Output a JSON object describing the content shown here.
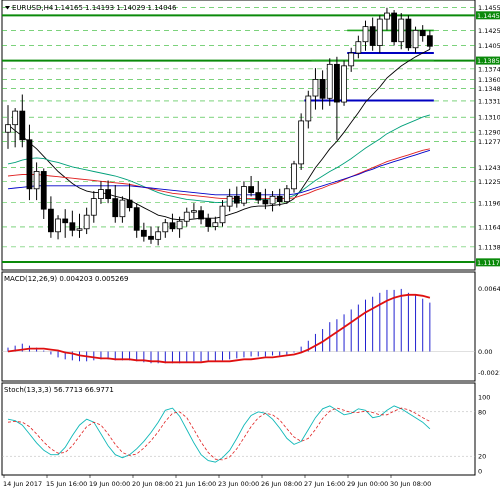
{
  "main": {
    "symbol_title": "EURUSD,H4",
    "ohlc": "1.14165 1.14193 1.14029 1.14046",
    "price_labels": [
      "1.14555",
      "1.14450",
      "1.14250",
      "1.14050",
      "1.13850",
      "1.13740",
      "1.13600",
      "1.13480",
      "1.13315",
      "1.13100",
      "1.12900",
      "1.12775",
      "1.12430",
      "1.12250",
      "1.11965",
      "1.11645",
      "1.11380"
    ],
    "green_tag_labels": [
      "1.14450",
      "1.13850",
      "1.11175"
    ],
    "ylim": [
      1.111,
      1.146
    ],
    "candles": [
      [
        1.129,
        1.1326,
        1.1268,
        1.13
      ],
      [
        1.13,
        1.1322,
        1.127,
        1.1318
      ],
      [
        1.1318,
        1.134,
        1.127,
        1.128
      ],
      [
        1.128,
        1.13,
        1.12,
        1.1215
      ],
      [
        1.1215,
        1.125,
        1.12,
        1.1238
      ],
      [
        1.1238,
        1.1242,
        1.1175,
        1.1188
      ],
      [
        1.1188,
        1.1205,
        1.115,
        1.1158
      ],
      [
        1.1158,
        1.118,
        1.1148,
        1.1175
      ],
      [
        1.1175,
        1.1188,
        1.115,
        1.117
      ],
      [
        1.117,
        1.1186,
        1.1152,
        1.116
      ],
      [
        1.116,
        1.1182,
        1.115,
        1.1162
      ],
      [
        1.1162,
        1.119,
        1.1155,
        1.118
      ],
      [
        1.118,
        1.1212,
        1.117,
        1.1202
      ],
      [
        1.1202,
        1.1225,
        1.1195,
        1.1214
      ],
      [
        1.1214,
        1.1226,
        1.1196,
        1.1202
      ],
      [
        1.1202,
        1.122,
        1.117,
        1.1178
      ],
      [
        1.1178,
        1.1205,
        1.117,
        1.12
      ],
      [
        1.12,
        1.1222,
        1.1185,
        1.119
      ],
      [
        1.119,
        1.1196,
        1.115,
        1.116
      ],
      [
        1.116,
        1.117,
        1.1145,
        1.1152
      ],
      [
        1.1152,
        1.1165,
        1.1142,
        1.1148
      ],
      [
        1.1148,
        1.1165,
        1.114,
        1.1158
      ],
      [
        1.1158,
        1.1175,
        1.115,
        1.117
      ],
      [
        1.117,
        1.1182,
        1.1158,
        1.1162
      ],
      [
        1.1162,
        1.1178,
        1.115,
        1.1172
      ],
      [
        1.1172,
        1.119,
        1.1165,
        1.1184
      ],
      [
        1.1184,
        1.1196,
        1.1176,
        1.1186
      ],
      [
        1.1186,
        1.1192,
        1.1168,
        1.1175
      ],
      [
        1.1175,
        1.1182,
        1.1158,
        1.1165
      ],
      [
        1.1165,
        1.1178,
        1.116,
        1.117
      ],
      [
        1.117,
        1.12,
        1.1165,
        1.1192
      ],
      [
        1.1192,
        1.1215,
        1.1185,
        1.1205
      ],
      [
        1.1205,
        1.1218,
        1.119,
        1.1196
      ],
      [
        1.1196,
        1.1225,
        1.1192,
        1.1218
      ],
      [
        1.1218,
        1.1232,
        1.1205,
        1.121
      ],
      [
        1.121,
        1.1225,
        1.1195,
        1.12
      ],
      [
        1.12,
        1.1215,
        1.1188,
        1.1195
      ],
      [
        1.1195,
        1.1212,
        1.1185,
        1.1205
      ],
      [
        1.1205,
        1.1215,
        1.1192,
        1.1198
      ],
      [
        1.1198,
        1.122,
        1.1195,
        1.1215
      ],
      [
        1.1215,
        1.1252,
        1.121,
        1.1248
      ],
      [
        1.1248,
        1.1315,
        1.124,
        1.1305
      ],
      [
        1.1305,
        1.1345,
        1.1295,
        1.1338
      ],
      [
        1.1338,
        1.1375,
        1.132,
        1.136
      ],
      [
        1.136,
        1.1372,
        1.132,
        1.1335
      ],
      [
        1.1335,
        1.1388,
        1.1325,
        1.138
      ],
      [
        1.138,
        1.139,
        1.128,
        1.133
      ],
      [
        1.133,
        1.1385,
        1.1325,
        1.1378
      ],
      [
        1.1378,
        1.1402,
        1.137,
        1.1395
      ],
      [
        1.1395,
        1.1418,
        1.1388,
        1.141
      ],
      [
        1.141,
        1.1438,
        1.1398,
        1.143
      ],
      [
        1.143,
        1.1442,
        1.1398,
        1.1405
      ],
      [
        1.1405,
        1.1445,
        1.1395,
        1.144
      ],
      [
        1.144,
        1.1455,
        1.1425,
        1.1448
      ],
      [
        1.1448,
        1.1452,
        1.1405,
        1.141
      ],
      [
        1.141,
        1.1448,
        1.14,
        1.144
      ],
      [
        1.144,
        1.1445,
        1.1398,
        1.1402
      ],
      [
        1.1402,
        1.143,
        1.1395,
        1.1425
      ],
      [
        1.1425,
        1.1432,
        1.141,
        1.1418
      ],
      [
        1.1418,
        1.1425,
        1.14,
        1.1404
      ]
    ],
    "moving_averages": [
      {
        "color": "#000000",
        "values": [
          1.13,
          1.1292,
          1.1285,
          1.1276,
          1.1268,
          1.1258,
          1.1248,
          1.1238,
          1.123,
          1.1222,
          1.1216,
          1.1212,
          1.121,
          1.121,
          1.1208,
          1.1205,
          1.1203,
          1.12,
          1.1195,
          1.119,
          1.1185,
          1.118,
          1.1178,
          1.1175,
          1.1174,
          1.1174,
          1.1175,
          1.1176,
          1.1176,
          1.1176,
          1.1178,
          1.1181,
          1.1184,
          1.1188,
          1.1191,
          1.1192,
          1.1192,
          1.1193,
          1.1194,
          1.1196,
          1.1202,
          1.1214,
          1.1228,
          1.1243,
          1.1255,
          1.1268,
          1.1278,
          1.129,
          1.1303,
          1.1316,
          1.133,
          1.134,
          1.135,
          1.1362,
          1.137,
          1.1378,
          1.1384,
          1.139,
          1.1395,
          1.14
        ]
      },
      {
        "color": "#00a07a",
        "values": [
          1.1248,
          1.125,
          1.1253,
          1.1255,
          1.1256,
          1.1255,
          1.1252,
          1.125,
          1.1247,
          1.1244,
          1.1242,
          1.124,
          1.1238,
          1.1236,
          1.1234,
          1.1232,
          1.1229,
          1.1226,
          1.1222,
          1.1218,
          1.1214,
          1.121,
          1.1207,
          1.1205,
          1.1203,
          1.1201,
          1.12,
          1.1199,
          1.1198,
          1.1197,
          1.1197,
          1.1198,
          1.1199,
          1.12,
          1.1201,
          1.1201,
          1.1201,
          1.1202,
          1.1202,
          1.1203,
          1.1206,
          1.1212,
          1.1219,
          1.1226,
          1.1232,
          1.1238,
          1.1243,
          1.1249,
          1.1255,
          1.1262,
          1.1269,
          1.1275,
          1.1281,
          1.1288,
          1.1293,
          1.1298,
          1.1302,
          1.1306,
          1.131,
          1.1313
        ]
      },
      {
        "color": "#e02020",
        "values": [
          1.1232,
          1.1233,
          1.1234,
          1.1234,
          1.1234,
          1.1233,
          1.1232,
          1.1231,
          1.123,
          1.1229,
          1.1228,
          1.1227,
          1.1226,
          1.1225,
          1.1224,
          1.1223,
          1.1222,
          1.1221,
          1.1219,
          1.1217,
          1.1215,
          1.1213,
          1.1211,
          1.1209,
          1.1208,
          1.1207,
          1.1206,
          1.1205,
          1.1204,
          1.1203,
          1.1202,
          1.1202,
          1.1202,
          1.1202,
          1.1202,
          1.1202,
          1.1202,
          1.1202,
          1.1202,
          1.1202,
          1.1203,
          1.1206,
          1.1209,
          1.1213,
          1.1216,
          1.122,
          1.1223,
          1.1227,
          1.1231,
          1.1235,
          1.1239,
          1.1243,
          1.1247,
          1.1251,
          1.1254,
          1.1257,
          1.126,
          1.1263,
          1.1266,
          1.1268
        ]
      },
      {
        "color": "#0000c8",
        "values": [
          1.1215,
          1.1216,
          1.1217,
          1.1218,
          1.1219,
          1.1219,
          1.1219,
          1.1219,
          1.1219,
          1.1219,
          1.1219,
          1.1219,
          1.1219,
          1.1219,
          1.1219,
          1.1219,
          1.1219,
          1.1219,
          1.1218,
          1.1217,
          1.1216,
          1.1215,
          1.1214,
          1.1213,
          1.1212,
          1.1211,
          1.121,
          1.1209,
          1.1208,
          1.1207,
          1.1207,
          1.1207,
          1.1207,
          1.1207,
          1.1207,
          1.1207,
          1.1207,
          1.1207,
          1.1207,
          1.1207,
          1.1208,
          1.121,
          1.1213,
          1.1216,
          1.1219,
          1.1222,
          1.1225,
          1.1228,
          1.1231,
          1.1234,
          1.1238,
          1.1241,
          1.1245,
          1.1248,
          1.1251,
          1.1254,
          1.1257,
          1.126,
          1.1263,
          1.1266
        ]
      }
    ],
    "green_levels": [
      1.1445,
      1.1385,
      1.1118
    ],
    "green_segments": [
      {
        "value": 1.1425,
        "from": 48,
        "to": 59
      },
      {
        "value": 1.1385,
        "from": 43,
        "to": 59
      }
    ],
    "blue_segments": [
      {
        "value": 1.1395,
        "from": 48,
        "to": 59
      },
      {
        "value": 1.1332,
        "from": 42,
        "to": 59
      }
    ]
  },
  "macd": {
    "title": "MACD(12,26,9) 0.004203 0.005269",
    "labels": [
      "0.006446",
      "0.00",
      "-0.00213"
    ],
    "ylim": [
      -0.0024,
      0.0068
    ],
    "histogram": [
      0.0004,
      0.0006,
      0.0008,
      0.0006,
      0.0004,
      0.0001,
      -0.0003,
      -0.0006,
      -0.0008,
      -0.0009,
      -0.001,
      -0.001,
      -0.0009,
      -0.0008,
      -0.0008,
      -0.0009,
      -0.0009,
      -0.0009,
      -0.001,
      -0.0011,
      -0.0012,
      -0.0012,
      -0.0012,
      -0.0012,
      -0.0012,
      -0.0011,
      -0.001,
      -0.001,
      -0.001,
      -0.001,
      -0.0009,
      -0.0008,
      -0.0007,
      -0.0006,
      -0.0005,
      -0.0005,
      -0.0005,
      -0.0004,
      -0.0004,
      -0.0003,
      -0.0001,
      0.0005,
      0.0011,
      0.0018,
      0.0023,
      0.003,
      0.0033,
      0.0038,
      0.0043,
      0.0048,
      0.0053,
      0.0056,
      0.006,
      0.0063,
      0.0063,
      0.0064,
      0.006,
      0.0058,
      0.0054,
      0.005
    ],
    "signal": [
      0.0,
      0.0001,
      0.0002,
      0.0003,
      0.0003,
      0.0003,
      0.0002,
      0.0001,
      -0.0001,
      -0.0002,
      -0.0004,
      -0.0005,
      -0.0006,
      -0.0007,
      -0.0007,
      -0.0008,
      -0.0008,
      -0.0008,
      -0.0009,
      -0.0009,
      -0.001,
      -0.001,
      -0.0011,
      -0.0011,
      -0.0011,
      -0.0011,
      -0.0011,
      -0.0011,
      -0.001,
      -0.001,
      -0.001,
      -0.001,
      -0.0009,
      -0.0008,
      -0.0008,
      -0.0007,
      -0.0006,
      -0.0006,
      -0.0005,
      -0.0004,
      -0.0003,
      -0.0001,
      0.0002,
      0.0006,
      0.001,
      0.0015,
      0.002,
      0.0025,
      0.003,
      0.0035,
      0.004,
      0.0044,
      0.0048,
      0.0052,
      0.0055,
      0.0057,
      0.0058,
      0.0058,
      0.0057,
      0.0055
    ]
  },
  "stoch": {
    "title": "Stoch(13,3,3) 56.7713 66.9771",
    "labels": [
      "100",
      "80",
      "20",
      "0"
    ],
    "main": [
      70,
      68,
      62,
      50,
      38,
      28,
      22,
      22,
      32,
      48,
      62,
      70,
      66,
      50,
      34,
      22,
      18,
      22,
      30,
      40,
      52,
      66,
      82,
      85,
      74,
      56,
      38,
      22,
      14,
      12,
      18,
      28,
      44,
      62,
      75,
      80,
      78,
      70,
      58,
      44,
      36,
      40,
      56,
      72,
      84,
      88,
      82,
      76,
      78,
      84,
      82,
      72,
      74,
      82,
      88,
      84,
      78,
      72,
      66,
      57
    ],
    "signal": [
      66,
      67,
      66,
      60,
      50,
      39,
      30,
      24,
      25,
      34,
      47,
      60,
      66,
      62,
      50,
      36,
      25,
      21,
      23,
      31,
      41,
      53,
      67,
      78,
      80,
      72,
      56,
      39,
      25,
      16,
      15,
      19,
      30,
      45,
      60,
      72,
      78,
      76,
      69,
      57,
      46,
      40,
      44,
      56,
      71,
      81,
      85,
      82,
      79,
      79,
      81,
      79,
      76,
      76,
      81,
      85,
      83,
      78,
      72,
      67
    ]
  },
  "time_labels": [
    "14 Jun 2017",
    "15 Jun 16:00",
    "19 Jun 00:00",
    "20 Jun 08:00",
    "21 Jun 16:00",
    "23 Jun 00:00",
    "26 Jun 08:00",
    "27 Jun 16:00",
    "29 Jun 00:00",
    "30 Jun 08:00"
  ]
}
